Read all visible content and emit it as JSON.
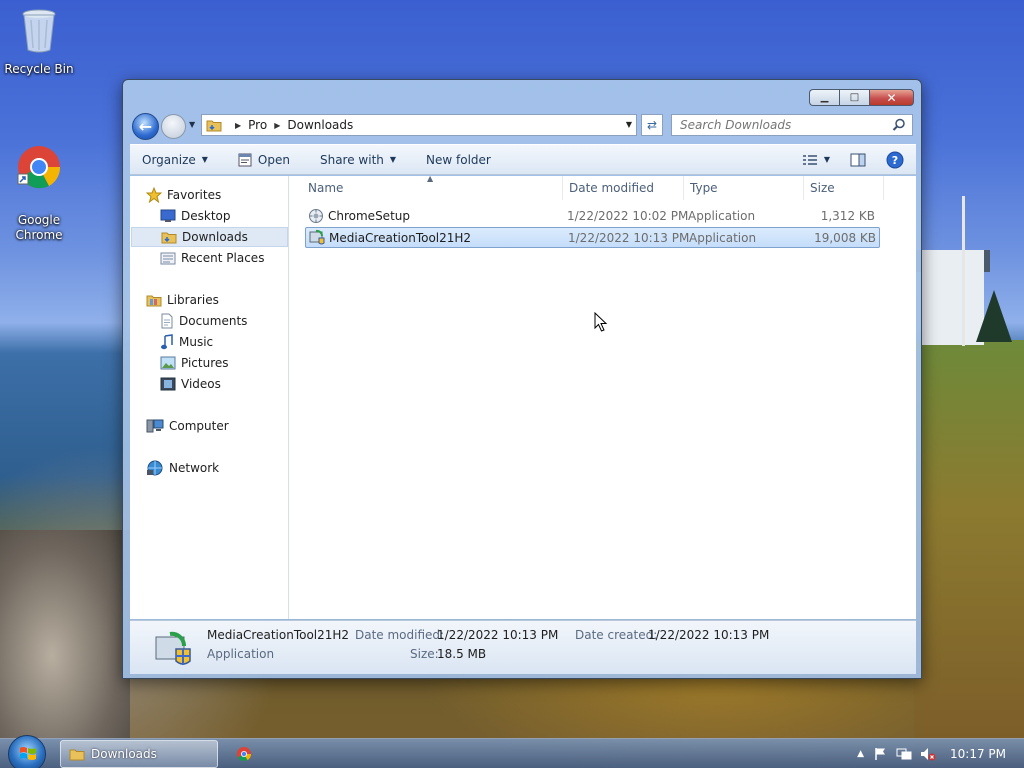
{
  "desktop": {
    "icons": [
      {
        "label": "Recycle Bin",
        "icon": "recycle-bin-icon"
      },
      {
        "label": "Google\nChrome",
        "icon": "chrome-icon"
      }
    ]
  },
  "window": {
    "address": {
      "crumbs": [
        "Pro",
        "Downloads"
      ]
    },
    "search": {
      "placeholder": "Search Downloads"
    },
    "toolbar": {
      "organize": "Organize",
      "open": "Open",
      "share_with": "Share with",
      "new_folder": "New folder"
    },
    "nav": {
      "favorites": "Favorites",
      "desktop": "Desktop",
      "downloads": "Downloads",
      "recent_places": "Recent Places",
      "libraries": "Libraries",
      "documents": "Documents",
      "music": "Music",
      "pictures": "Pictures",
      "videos": "Videos",
      "computer": "Computer",
      "network": "Network"
    },
    "columns": {
      "name": "Name",
      "date_modified": "Date modified",
      "type": "Type",
      "size": "Size"
    },
    "files": [
      {
        "name": "ChromeSetup",
        "date_modified": "1/22/2022 10:02 PM",
        "type": "Application",
        "size": "1,312 KB"
      },
      {
        "name": "MediaCreationTool21H2",
        "date_modified": "1/22/2022 10:13 PM",
        "type": "Application",
        "size": "19,008 KB"
      }
    ],
    "details": {
      "name": "MediaCreationTool21H2",
      "kind": "Application",
      "date_modified_label": "Date modified:",
      "date_modified": "1/22/2022 10:13 PM",
      "date_created_label": "Date created:",
      "date_created": "1/22/2022 10:13 PM",
      "size_label": "Size:",
      "size": "18.5 MB"
    }
  },
  "taskbar": {
    "active_task": "Downloads",
    "clock": "10:17 PM"
  }
}
